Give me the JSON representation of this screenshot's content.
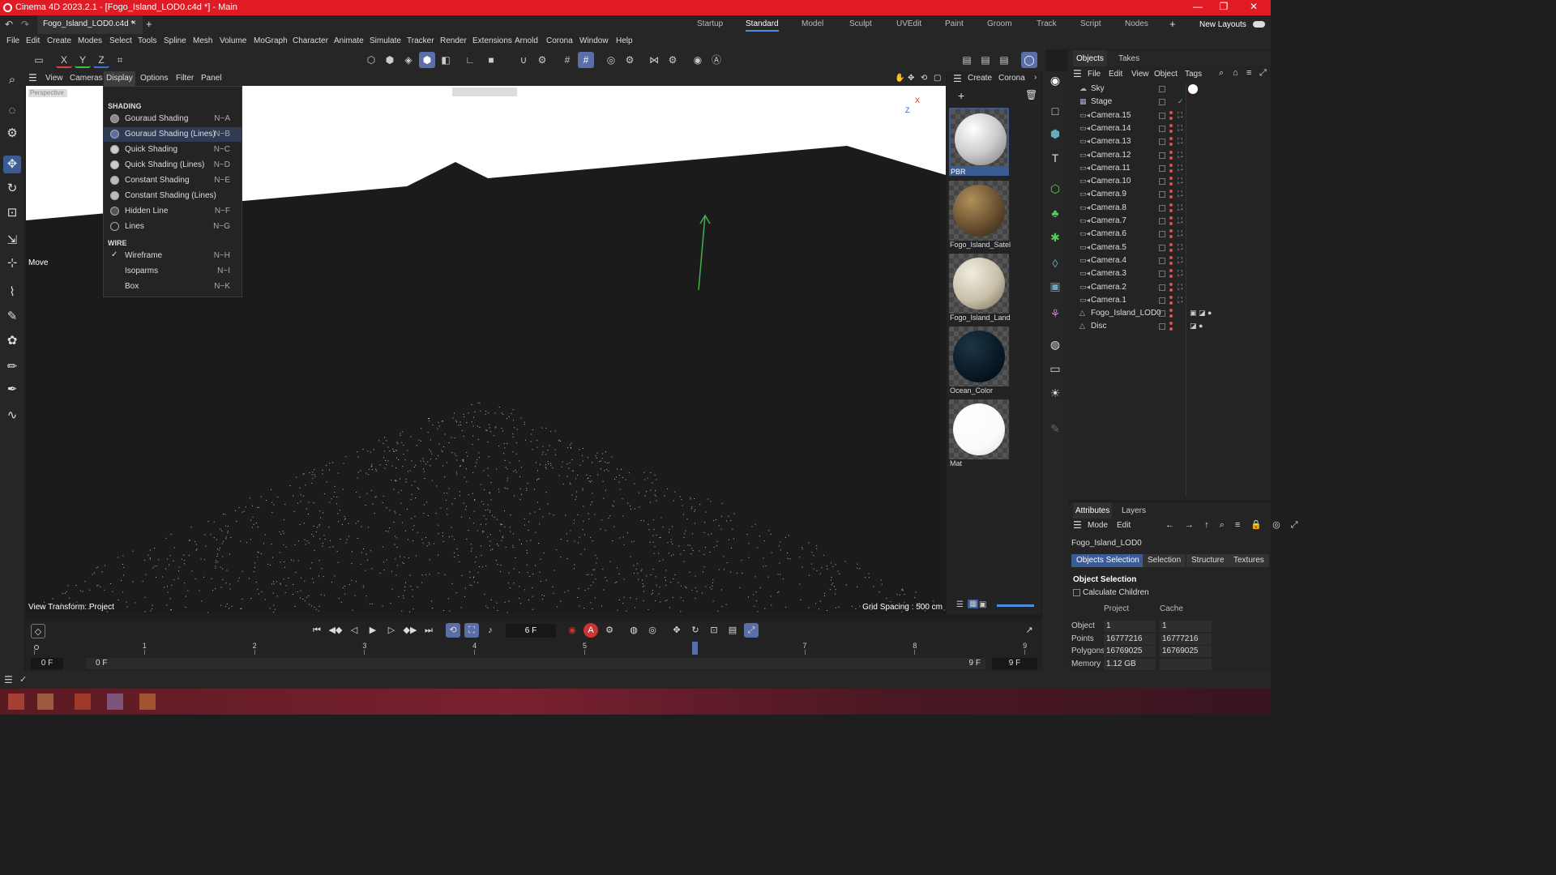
{
  "window": {
    "title": "Cinema 4D 2023.2.1 - [Fogo_Island_LOD0.c4d *] - Main",
    "controls": [
      "—",
      "❐",
      "✕"
    ]
  },
  "tabs": {
    "doc": "Fogo_Island_LOD0.c4d *",
    "close": "×",
    "add": "+"
  },
  "layouts": [
    "Startup",
    "Standard",
    "Model",
    "Sculpt",
    "UVEdit",
    "Paint",
    "Groom",
    "Track",
    "Script",
    "Nodes"
  ],
  "layouts_active": "Standard",
  "new_layouts": "New Layouts",
  "menu": [
    "File",
    "Edit",
    "Create",
    "Modes",
    "Select",
    "Tools",
    "Spline",
    "Mesh",
    "Volume",
    "MoGraph",
    "Character",
    "Animate",
    "Simulate",
    "Tracker",
    "Render",
    "Extensions",
    "Arnold",
    "Corona",
    "Window",
    "Help"
  ],
  "axis": {
    "x": "X",
    "y": "Y",
    "z": "Z"
  },
  "viewport_menu": [
    "View",
    "Cameras",
    "Display",
    "Options",
    "Filter",
    "Panel"
  ],
  "viewport": {
    "camera": "Perspective",
    "tool": "Move",
    "view_transform": "View Transform: Project",
    "grid": "Grid Spacing : 500 cm",
    "axis_x": "X",
    "axis_z": "Z"
  },
  "display_menu": {
    "shading_header": "SHADING",
    "shading": [
      {
        "label": "Gouraud Shading",
        "shortcut": "N~A"
      },
      {
        "label": "Gouraud Shading (Lines)",
        "shortcut": "N~B"
      },
      {
        "label": "Quick Shading",
        "shortcut": "N~C"
      },
      {
        "label": "Quick Shading (Lines)",
        "shortcut": "N~D"
      },
      {
        "label": "Constant Shading",
        "shortcut": "N~E"
      },
      {
        "label": "Constant Shading (Lines)",
        "shortcut": ""
      },
      {
        "label": "Hidden Line",
        "shortcut": "N~F"
      },
      {
        "label": "Lines",
        "shortcut": "N~G"
      }
    ],
    "wire_header": "WIRE",
    "wire": [
      {
        "label": "Wireframe",
        "shortcut": "N~H",
        "checked": "✓"
      },
      {
        "label": "Isoparms",
        "shortcut": "N~I"
      },
      {
        "label": "Box",
        "shortcut": "N~K"
      }
    ]
  },
  "material_menu": [
    "Create",
    "Corona"
  ],
  "materials": [
    "PBR",
    "Fogo_Island_Satel",
    "Fogo_Island_Land",
    "Ocean_Color",
    "Mat"
  ],
  "objects_tabs": [
    "Objects",
    "Takes"
  ],
  "objects_menu": [
    "File",
    "Edit",
    "View",
    "Object",
    "Tags"
  ],
  "objects": [
    "Sky",
    "Stage",
    "Camera.15",
    "Camera.14",
    "Camera.13",
    "Camera.12",
    "Camera.11",
    "Camera.10",
    "Camera.9",
    "Camera.8",
    "Camera.7",
    "Camera.6",
    "Camera.5",
    "Camera.4",
    "Camera.3",
    "Camera.2",
    "Camera.1",
    "Fogo_Island_LOD0",
    "Disc"
  ],
  "attributes": {
    "tabs": [
      "Attributes",
      "Layers"
    ],
    "menu": [
      "Mode",
      "Edit"
    ],
    "object_name": "Fogo_Island_LOD0",
    "subtabs": [
      "Objects Selection",
      "Selection",
      "Structure",
      "Textures"
    ],
    "section": "Object Selection",
    "calc_children": "Calculate Children",
    "col_project": "Project",
    "col_cache": "Cache",
    "rows": [
      {
        "label": "Object",
        "project": "1",
        "cache": "1"
      },
      {
        "label": "Points",
        "project": "16777216",
        "cache": "16777216"
      },
      {
        "label": "Polygons",
        "project": "16769025",
        "cache": "16769025"
      },
      {
        "label": "Memory",
        "project": "1.12 GB",
        "cache": ""
      }
    ]
  },
  "timeline": {
    "frame": "6 F",
    "start": "0 F",
    "start2": "0 F",
    "end": "9 F",
    "end2": "9 F",
    "ticks": [
      "0",
      "1",
      "2",
      "3",
      "4",
      "5",
      "6",
      "7",
      "8",
      "9"
    ],
    "current": 6,
    "max": 9
  },
  "colors": {
    "title_bar": "#e01b24",
    "accent": "#4a8fe0",
    "selection": "#3a5b93"
  }
}
